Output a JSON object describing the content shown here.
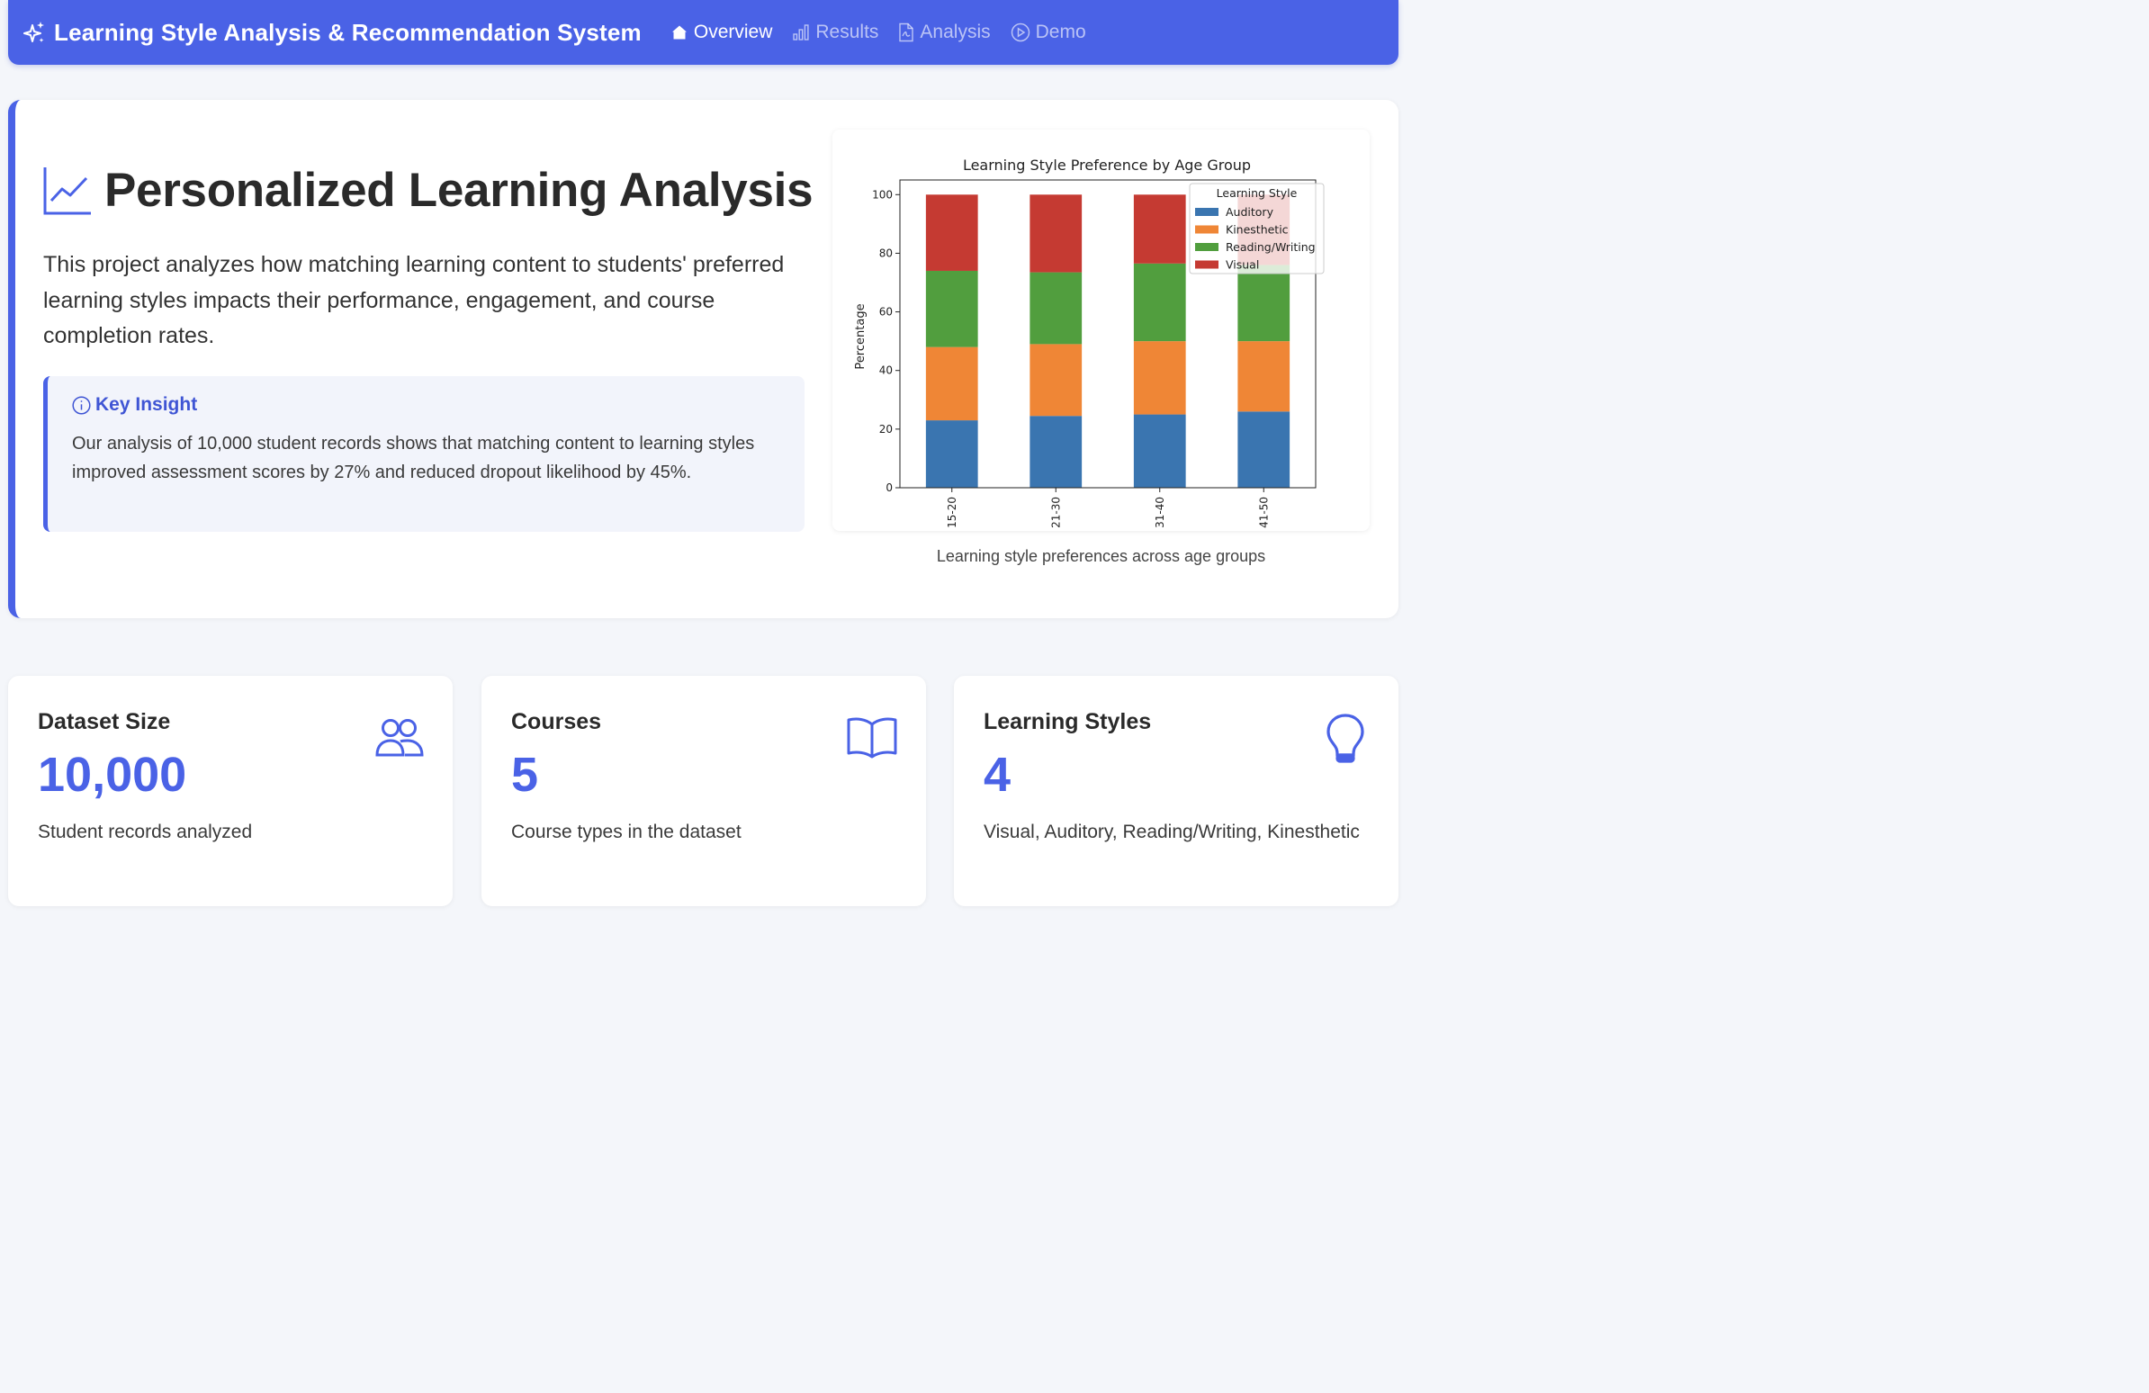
{
  "navbar": {
    "brand": "Learning Style Analysis & Recommendation System",
    "links": [
      {
        "label": "Overview",
        "icon": "home-icon",
        "active": true
      },
      {
        "label": "Results",
        "icon": "bar-chart-icon",
        "active": false
      },
      {
        "label": "Analysis",
        "icon": "document-icon",
        "active": false
      },
      {
        "label": "Demo",
        "icon": "play-circle-icon",
        "active": false
      }
    ]
  },
  "hero": {
    "title": "Personalized Learning Analysis",
    "description": "This project analyzes how matching learning content to students' preferred learning styles impacts their performance, engagement, and course completion rates.",
    "insight": {
      "heading": "Key Insight",
      "text": "Our analysis of 10,000 student records shows that matching content to learning styles improved assessment scores by 27% and reduced dropout likelihood by 45%."
    },
    "chart_caption": "Learning style preferences across age groups"
  },
  "chart_data": {
    "type": "bar",
    "stacked": true,
    "title": "Learning Style Preference by Age Group",
    "xlabel": "",
    "ylabel": "Percentage",
    "ylim": [
      0,
      105
    ],
    "yticks": [
      0,
      20,
      40,
      60,
      80,
      100
    ],
    "categories": [
      "15-20",
      "21-30",
      "31-40",
      "41-50"
    ],
    "legend_title": "Learning Style",
    "legend_position": "top-right",
    "series": [
      {
        "name": "Auditory",
        "color": "#3a75b0",
        "values": [
          23,
          24.5,
          25,
          26
        ]
      },
      {
        "name": "Kinesthetic",
        "color": "#ef8636",
        "values": [
          25,
          24.5,
          25,
          24
        ]
      },
      {
        "name": "Reading/Writing",
        "color": "#519e3e",
        "values": [
          26,
          24.5,
          26.5,
          26
        ]
      },
      {
        "name": "Visual",
        "color": "#c53a32",
        "values": [
          26,
          26.5,
          23.5,
          24
        ]
      }
    ]
  },
  "stats": [
    {
      "title": "Dataset Size",
      "value": "10,000",
      "description": "Student records analyzed",
      "icon": "users-icon",
      "color": "#4a62e6"
    },
    {
      "title": "Courses",
      "value": "5",
      "description": "Course types in the dataset",
      "icon": "book-icon",
      "color": "#4a62e6"
    },
    {
      "title": "Learning Styles",
      "value": "4",
      "description": "Visual, Auditory, Reading/Writing, Kinesthetic",
      "icon": "lightbulb-icon",
      "color": "#4a62e6"
    }
  ]
}
